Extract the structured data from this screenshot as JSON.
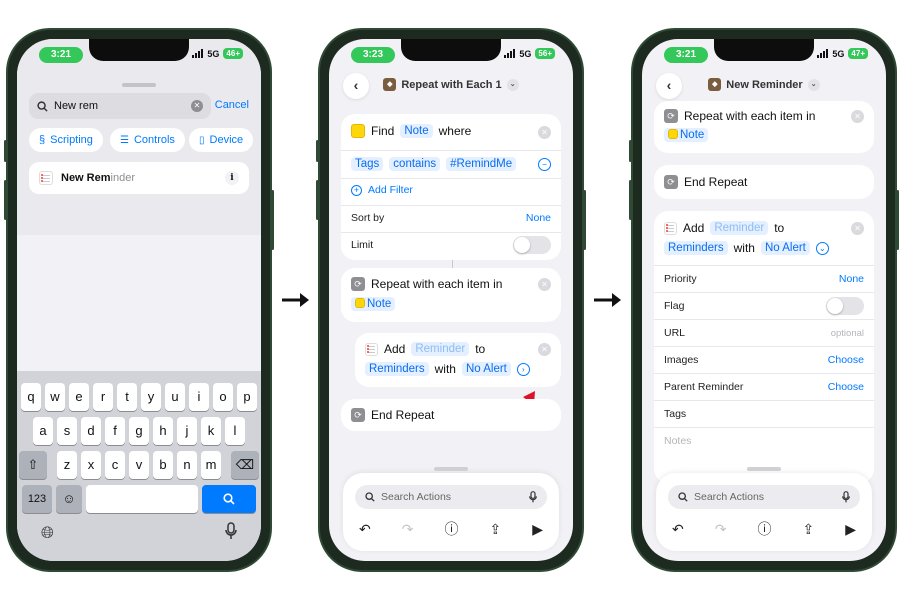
{
  "phone1": {
    "time": "3:21",
    "network": "5G",
    "battery": "46+",
    "search": {
      "value": "New rem",
      "cancel": "Cancel"
    },
    "chips": [
      "Scripting",
      "Controls",
      "Device"
    ],
    "result": {
      "match": "New Rem",
      "rest": "inder"
    },
    "keyboard": {
      "row1": [
        "q",
        "w",
        "e",
        "r",
        "t",
        "y",
        "u",
        "i",
        "o",
        "p"
      ],
      "row2": [
        "a",
        "s",
        "d",
        "f",
        "g",
        "h",
        "j",
        "k",
        "l"
      ],
      "row3": [
        "z",
        "x",
        "c",
        "v",
        "b",
        "n",
        "m"
      ],
      "numbers_key": "123"
    }
  },
  "phone2": {
    "time": "3:23",
    "network": "5G",
    "battery": "56+",
    "title": "Repeat with Each 1",
    "find": {
      "verb": "Find",
      "noun": "Note",
      "suffix": "where"
    },
    "filter": {
      "field": "Tags",
      "op": "contains",
      "value": "#RemindMe"
    },
    "add_filter": "Add Filter",
    "sort_by": {
      "label": "Sort by",
      "value": "None"
    },
    "limit": {
      "label": "Limit"
    },
    "repeat": {
      "title": "Repeat with each item in",
      "var": "Note"
    },
    "add": {
      "verb": "Add",
      "item": "Reminder",
      "to": "to",
      "list": "Reminders",
      "with": "with",
      "alert": "No Alert"
    },
    "end_repeat": "End Repeat",
    "search_placeholder": "Search Actions"
  },
  "phone3": {
    "time": "3:21",
    "network": "5G",
    "battery": "47+",
    "title": "New Reminder",
    "repeat": {
      "title": "Repeat with each item in",
      "var": "Note"
    },
    "end_repeat": "End Repeat",
    "add": {
      "verb": "Add",
      "item": "Reminder",
      "to": "to",
      "list": "Reminders",
      "with": "with",
      "alert": "No Alert"
    },
    "params": {
      "priority": {
        "label": "Priority",
        "value": "None"
      },
      "flag": {
        "label": "Flag"
      },
      "url": {
        "label": "URL",
        "placeholder": "optional"
      },
      "images": {
        "label": "Images",
        "value": "Choose"
      },
      "parent": {
        "label": "Parent Reminder",
        "value": "Choose"
      },
      "tags": {
        "label": "Tags"
      },
      "notes": {
        "placeholder": "Notes"
      }
    },
    "search_placeholder": "Search Actions"
  },
  "colors": {
    "accent": "#007aff",
    "status_green": "#34c759",
    "bezel": "#1c2a1f",
    "annotation_red": "#e0102a"
  }
}
